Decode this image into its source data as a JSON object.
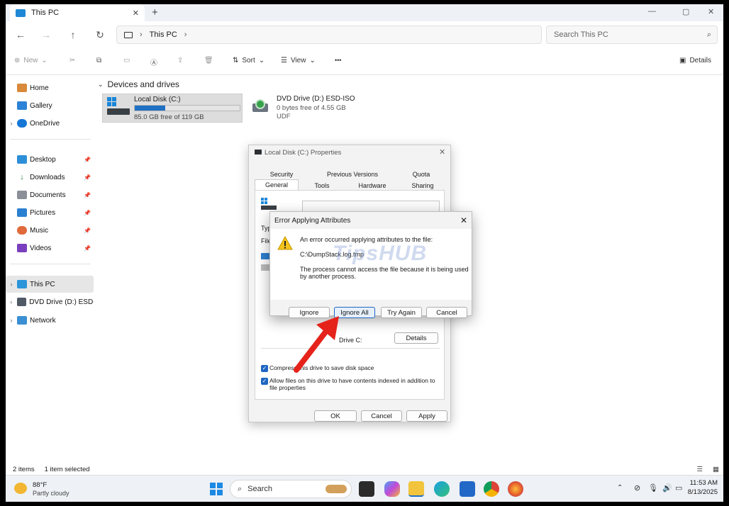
{
  "window": {
    "tab_title": "This PC",
    "new_tab": "+",
    "controls": {
      "minimize": "—",
      "maximize": "▢",
      "close": "✕"
    }
  },
  "nav": {
    "breadcrumb": [
      "This PC"
    ],
    "search_placeholder": "Search This PC"
  },
  "toolbar": {
    "new": "New",
    "sort": "Sort",
    "view": "View",
    "more": "•••",
    "details": "Details"
  },
  "sidebar": {
    "items": [
      {
        "label": "Home",
        "icon": "home-icon"
      },
      {
        "label": "Gallery",
        "icon": "gallery-icon"
      },
      {
        "label": "OneDrive",
        "icon": "cloud-icon"
      },
      {
        "label": "Desktop",
        "icon": "desktop-icon"
      },
      {
        "label": "Downloads",
        "icon": "download-icon"
      },
      {
        "label": "Documents",
        "icon": "documents-icon"
      },
      {
        "label": "Pictures",
        "icon": "pictures-icon"
      },
      {
        "label": "Music",
        "icon": "music-icon"
      },
      {
        "label": "Videos",
        "icon": "videos-icon"
      },
      {
        "label": "This PC",
        "icon": "computer-icon"
      },
      {
        "label": "DVD Drive (D:) ESD-",
        "icon": "dvd-icon"
      },
      {
        "label": "Network",
        "icon": "network-icon"
      }
    ]
  },
  "content": {
    "section_title": "Devices and drives",
    "drives": [
      {
        "name": "Local Disk (C:)",
        "free": "85.0 GB free of 119 GB",
        "used_fraction": 0.29
      },
      {
        "name": "DVD Drive (D:) ESD-ISO",
        "free": "0 bytes free of 4.55 GB",
        "fs": "UDF"
      }
    ]
  },
  "properties_dialog": {
    "title": "Local Disk (C:) Properties",
    "tabs_row1": [
      "Security",
      "Previous Versions",
      "Quota"
    ],
    "tabs_row2": [
      "General",
      "Tools",
      "Hardware",
      "Sharing"
    ],
    "label_type": "Typ",
    "label_fs": "File",
    "drive_label": "Drive C:",
    "details_button": "Details",
    "compress": "Compress this drive to save disk space",
    "index": "Allow files on this drive to have contents indexed in addition to file properties",
    "ok": "OK",
    "cancel": "Cancel",
    "apply": "Apply"
  },
  "error_dialog": {
    "title": "Error Applying Attributes",
    "message": "An error occurred applying attributes to the file:",
    "file": "C:\\DumpStack.log.tmp",
    "reason": "The process cannot access the file because it is being used by another process.",
    "buttons": [
      "Ignore",
      "Ignore All",
      "Try Again",
      "Cancel"
    ],
    "watermark": "TipsHUB"
  },
  "status": {
    "items": "2 items",
    "selected": "1 item selected"
  },
  "taskbar": {
    "temp": "88°F",
    "weather": "Partly cloudy",
    "search": "Search",
    "time": "11:53 AM",
    "date": "8/13/2025"
  },
  "colors": {
    "accent": "#0a5fb4",
    "arrow": "#e5231b"
  }
}
